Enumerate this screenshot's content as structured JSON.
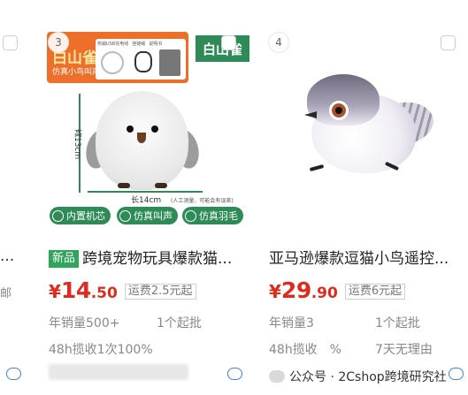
{
  "left_partial": {
    "title_ellipsis": "...",
    "shipping_fragment": "邮"
  },
  "card3": {
    "badge": "3",
    "image": {
      "brand": "白山雀",
      "brand_label_green": "白山雀",
      "sub_text": "仿真小鸟叫声",
      "box_items": [
        "热销USB充电线",
        "挂链绳",
        "说明书"
      ],
      "height_label": "高13cm",
      "length_label": "长14cm",
      "note": "(人工测量，可能会有误差)",
      "features": [
        "内置机芯",
        "仿真叫声",
        "仿真羽毛"
      ]
    },
    "tag": "新品",
    "title": "跨境宠物玩具爆款猫...",
    "price_symbol": "¥",
    "price_int": "14",
    "price_dec": ".50",
    "shipping": "运费2.5元起",
    "sales": "年销量500+",
    "min_order": "1个起批",
    "pickup_rate": "48h揽收1次100%"
  },
  "card4": {
    "badge": "4",
    "title": "亚马逊爆款逗猫小鸟遥控...",
    "price_symbol": "¥",
    "price_int": "29",
    "price_dec": ".90",
    "shipping": "运费6元起",
    "sales": "年销量3",
    "min_order": "1个起批",
    "pickup_rate": "48h揽收　%",
    "return_policy": "7天无理由"
  },
  "watermark": "公众号 · 2Cshop跨境研究社",
  "colors": {
    "price_red": "#e12a1e",
    "new_tag_green": "#2fa75a",
    "chat_icon_blue": "#4a7fd6",
    "image_orange": "#ee6f2a"
  }
}
